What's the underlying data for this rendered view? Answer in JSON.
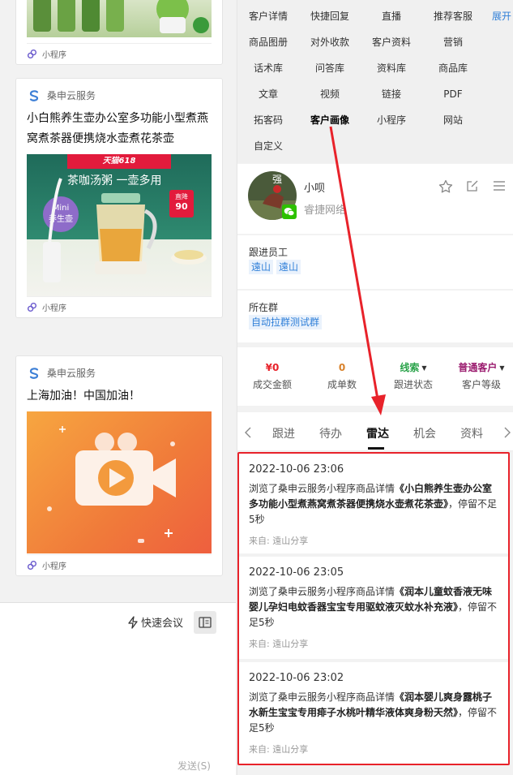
{
  "left_chat": {
    "card1": {
      "footer": "小程序"
    },
    "card2": {
      "service_name": "桑申云服务",
      "title": "小白熊养生壶办公室多功能小型煮燕窝煮茶器便携烧水壶煮花茶壶",
      "banner_brand": "天猫618",
      "banner_slogan": "茶咖汤粥 一壶多用",
      "badge_line1": "Mini",
      "badge_line2": "养生壶",
      "price_line1": "直降",
      "price_line2": "90",
      "footer": "小程序"
    },
    "card3": {
      "service_name": "桑申云服务",
      "title": "上海加油！中国加油！",
      "footer": "小程序"
    },
    "composer": {
      "quick_meeting": "快速会议",
      "send": "发送(S)"
    }
  },
  "right_panel": {
    "tools": [
      "客户详情",
      "快捷回复",
      "直播",
      "推荐客服",
      "展开",
      "商品图册",
      "对外收款",
      "客户资料",
      "营销",
      "话术库",
      "问答库",
      "资料库",
      "商品库",
      "文章",
      "视频",
      "链接",
      "PDF",
      "拓客码",
      "客户画像",
      "小程序",
      "网站",
      "自定义"
    ],
    "customer": {
      "name": "小呗",
      "company": "睿捷网络",
      "avatar_text": "强"
    },
    "follow_staff": {
      "label": "跟进员工",
      "tags": [
        "遠山",
        "遠山"
      ]
    },
    "group": {
      "label": "所在群",
      "tag": "自动拉群测试群"
    },
    "stats": {
      "deal_amount": {
        "value": "¥0",
        "label": "成交金额",
        "color": "#e8222a"
      },
      "order_count": {
        "value": "0",
        "label": "成单数",
        "color": "#d9822b"
      },
      "follow_status": {
        "value": "线索",
        "label": "跟进状态",
        "color": "#2aa34a"
      },
      "customer_level": {
        "value": "普通客户",
        "label": "客户等级",
        "color": "#9b1c6f"
      }
    },
    "tabs": [
      "跟进",
      "待办",
      "雷达",
      "机会",
      "资料"
    ],
    "active_tab": "雷达",
    "records": [
      {
        "time": "2022-10-06 23:06",
        "prefix": "浏览了桑申云服务小程序商品详情",
        "product": "《小白熊养生壶办公室多功能小型煮燕窝煮茶器便携烧水壶煮花茶壶》",
        "suffix": "，停留不足5秒",
        "source": "来自: 遠山分享"
      },
      {
        "time": "2022-10-06 23:05",
        "prefix": "浏览了桑申云服务小程序商品详情",
        "product": "《润本儿童蚊香液无味婴儿孕妇电蚊香器宝宝专用驱蚊液灭蚊水补充液》",
        "suffix": "，停留不足5秒",
        "source": "来自: 遠山分享"
      },
      {
        "time": "2022-10-06 23:02",
        "prefix": "浏览了桑申云服务小程序商品详情",
        "product": "《润本婴儿爽身露桃子水新生宝宝专用痱子水桃叶精华液体爽身粉天然》",
        "suffix": "，停留不足5秒",
        "source": "来自: 遠山分享"
      }
    ]
  },
  "colors": {
    "link_blue": "#2f7fd8",
    "highlight_red": "#e8222a",
    "wechat_green": "#2dc100"
  }
}
